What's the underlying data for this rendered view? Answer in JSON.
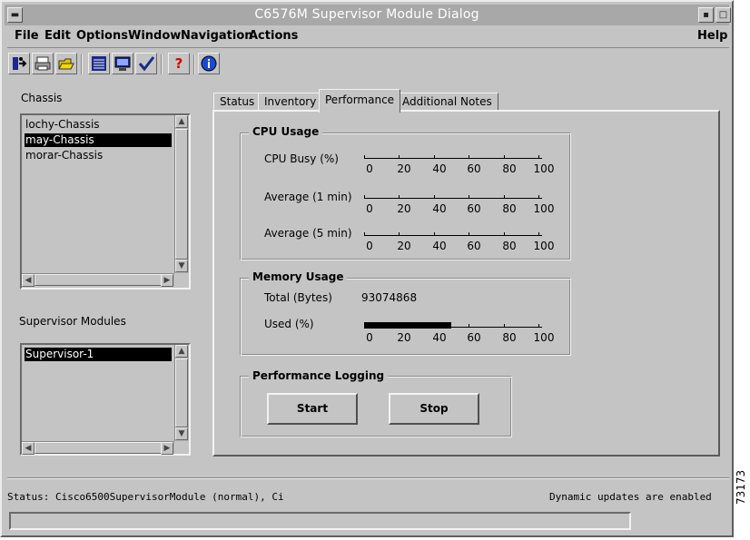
{
  "window": {
    "title": "C6576M Supervisor Module Dialog"
  },
  "menubar": {
    "items": [
      "File",
      "Edit",
      "Options",
      "Window",
      "Navigation",
      "Actions"
    ],
    "help": "Help"
  },
  "toolbar": {
    "icons": [
      "exit-icon",
      "print-icon",
      "open-folder-icon",
      "list-view-icon",
      "monitor-icon",
      "checkmark-icon",
      "question-help-icon",
      "info-icon"
    ]
  },
  "chassis": {
    "label": "Chassis",
    "items": [
      "lochy-Chassis",
      "may-Chassis",
      "morar-Chassis"
    ],
    "selected_index": 1
  },
  "supervisor": {
    "label": "Supervisor Modules",
    "items": [
      "Supervisor-1"
    ],
    "selected_index": 0
  },
  "tabs": [
    {
      "label": "Status"
    },
    {
      "label": "Inventory"
    },
    {
      "label": "Performance",
      "active": true
    },
    {
      "label": "Additional Notes"
    }
  ],
  "performance": {
    "cpu": {
      "title": "CPU Usage",
      "rows": [
        {
          "label": "CPU Busy (%)",
          "value": 0
        },
        {
          "label": "Average (1 min)",
          "value": 0
        },
        {
          "label": "Average (5 min)",
          "value": 0
        }
      ]
    },
    "memory": {
      "title": "Memory Usage",
      "total_label": "Total (Bytes)",
      "total_value": "93074868",
      "used_label": "Used (%)",
      "used_value": 50
    },
    "scale_ticks": [
      "0",
      "20",
      "40",
      "60",
      "80",
      "100"
    ],
    "logging": {
      "title": "Performance Logging",
      "start_label": "Start",
      "stop_label": "Stop"
    }
  },
  "status": {
    "text": "Status: Cisco6500SupervisorModule (normal), Ci",
    "updates": "Dynamic updates are enabled",
    "field_value": ""
  },
  "figure_id": "73173"
}
